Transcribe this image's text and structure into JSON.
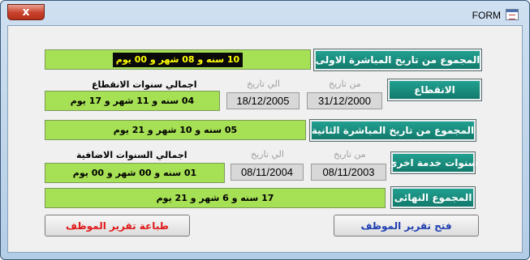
{
  "window": {
    "title": "FORM",
    "close_glyph": "x",
    "icon": "form-icon"
  },
  "sections": {
    "first_direct": {
      "button": "المجموع من تاريخ المباشرة الاولى",
      "value": "10 سنه و 08 شهر و 00 يوم"
    },
    "interruption": {
      "button": "الانقطاع",
      "total_label": "اجمالي سنوات الانقطاع",
      "from_label": "من تاريخ",
      "to_label": "الي تاريخ",
      "from_date": "31/12/2000",
      "to_date": "18/12/2005",
      "value": "04 سنه و 11 شهر و 17 يوم"
    },
    "second_direct": {
      "button": "المجموع من تاريخ المباشرة الثانية",
      "value": "05 سنه و 10 شهر و 21 يوم"
    },
    "other_service": {
      "button": "سنوات خدمة اخرى",
      "total_label": "اجمالي السنوات الاضافية",
      "from_label": "من تاريخ",
      "to_label": "الي تاريخ",
      "from_date": "08/11/2003",
      "to_date": "08/11/2004",
      "value": "01 سنه و 00 شهر و 00 يوم"
    },
    "final": {
      "button": "المجموع النهائى",
      "value": "17 سنه و 6 شهر و 21 يوم"
    }
  },
  "buttons": {
    "open_report": "فتح تقرير الموظف",
    "print_report": "طباعة تقرير الموظف"
  },
  "colors": {
    "green_box": "#a6e054",
    "teal_button": "#127a6c",
    "open_text": "#1f3fb0",
    "print_text": "#e01818"
  }
}
